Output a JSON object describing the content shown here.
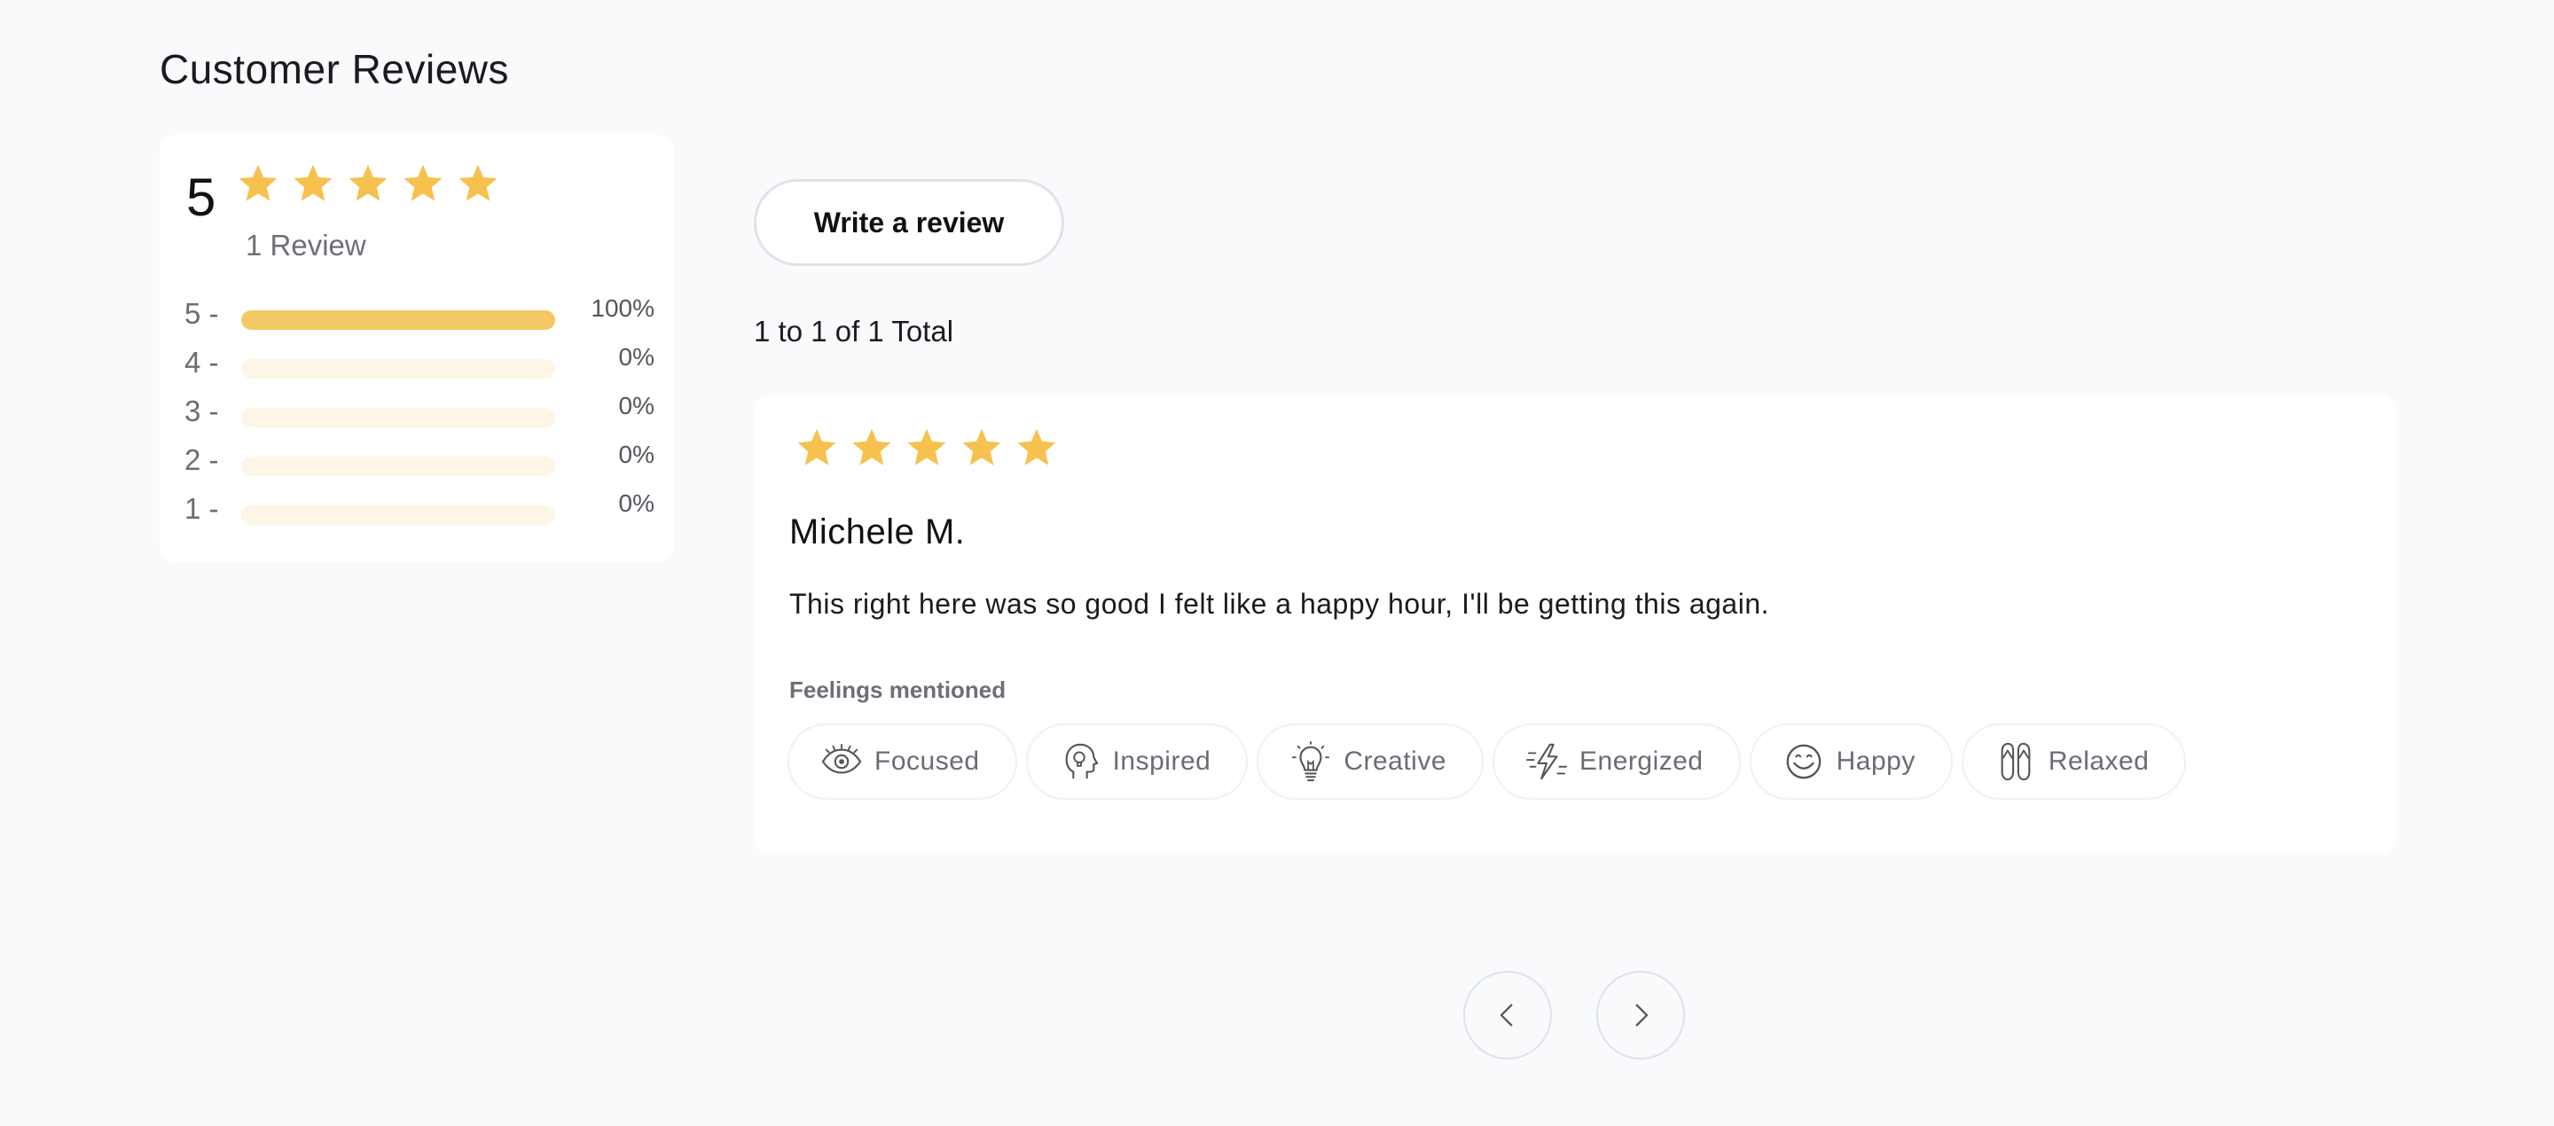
{
  "page": {
    "title": "Customer Reviews"
  },
  "colors": {
    "star": "#f6c14e",
    "bar_fill": "#f4c865",
    "bar_track": "#fdf6e6",
    "background": "#f9fafc"
  },
  "summary": {
    "average": "5",
    "average_stars": 5,
    "review_count": "1 Review",
    "distribution": [
      {
        "label": "5 -",
        "percent_text": "100%",
        "fraction": 1.0
      },
      {
        "label": "4 -",
        "percent_text": "0%",
        "fraction": 0.0
      },
      {
        "label": "3 -",
        "percent_text": "0%",
        "fraction": 0.0
      },
      {
        "label": "2 -",
        "percent_text": "0%",
        "fraction": 0.0
      },
      {
        "label": "1 -",
        "percent_text": "0%",
        "fraction": 0.0
      }
    ]
  },
  "actions": {
    "write_review_label": "Write a review"
  },
  "list": {
    "total_text": "1 to 1 of 1 Total"
  },
  "reviews": [
    {
      "rating": 5,
      "author": "Michele M.",
      "body": "This right here was so good I felt like a happy hour, I'll be getting this again.",
      "feelings_heading": "Feelings mentioned",
      "feelings": [
        {
          "label": "Focused",
          "icon": "eye-icon"
        },
        {
          "label": "Inspired",
          "icon": "head-idea-icon"
        },
        {
          "label": "Creative",
          "icon": "lightbulb-icon"
        },
        {
          "label": "Energized",
          "icon": "lightning-icon"
        },
        {
          "label": "Happy",
          "icon": "smiley-icon"
        },
        {
          "label": "Relaxed",
          "icon": "flip-flops-icon"
        }
      ]
    }
  ],
  "pagination": {
    "prev_icon": "chevron-left-icon",
    "next_icon": "chevron-right-icon"
  }
}
